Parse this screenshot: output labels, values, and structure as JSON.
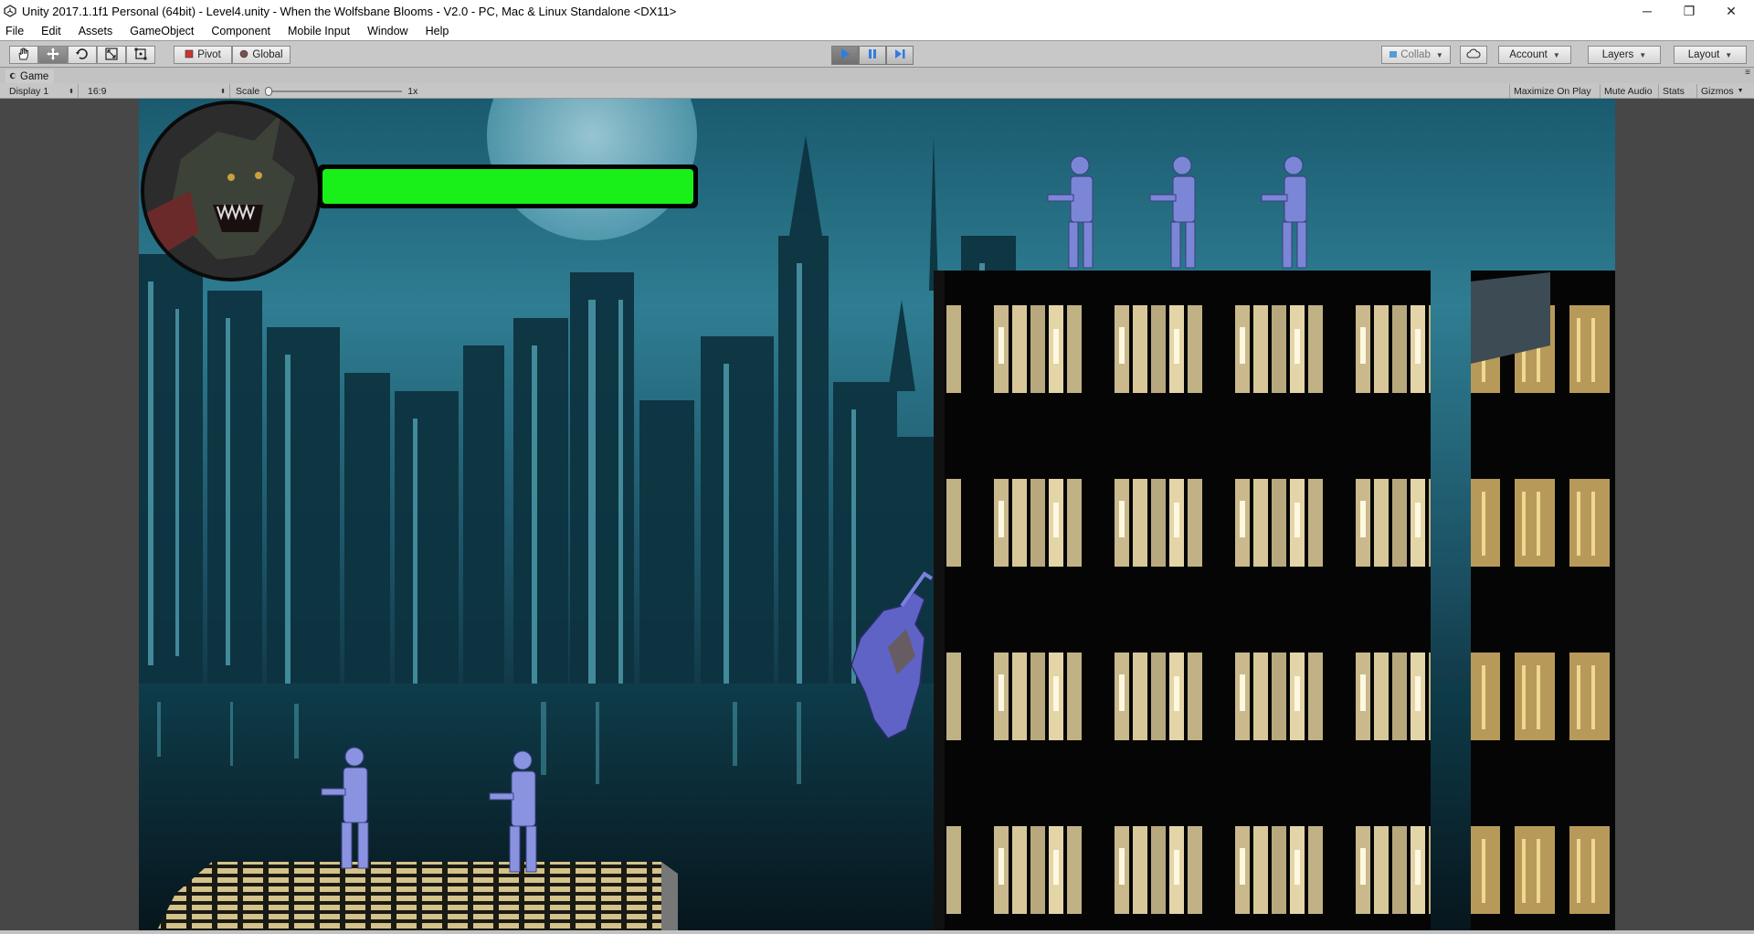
{
  "window": {
    "title": "Unity 2017.1.1f1 Personal (64bit) - Level4.unity - When the Wolfsbane Blooms - V2.0 - PC, Mac & Linux Standalone <DX11>",
    "minimize": "─",
    "maximize": "❐",
    "close": "✕"
  },
  "menu": [
    "File",
    "Edit",
    "Assets",
    "GameObject",
    "Component",
    "Mobile Input",
    "Window",
    "Help"
  ],
  "toolbar": {
    "pivot_label": "Pivot",
    "global_label": "Global",
    "collab_label": "Collab",
    "account_label": "Account",
    "layers_label": "Layers",
    "layout_label": "Layout",
    "transform_tools": [
      "hand-icon",
      "move-icon",
      "rotate-icon",
      "scale-icon",
      "rect-icon"
    ],
    "play_state": "playing"
  },
  "game_view": {
    "tab_label": "Game",
    "display": "Display 1",
    "aspect": "16:9",
    "scale_label": "Scale",
    "scale_value": "1x",
    "maximize_on_play": "Maximize On Play",
    "mute_audio": "Mute Audio",
    "stats": "Stats",
    "gizmos": "Gizmos"
  },
  "hud": {
    "health_fraction": 1.0,
    "health_color": "#19f019",
    "portrait": "werewolf-portrait-icon"
  },
  "colors": {
    "accent_blue": "#2f7de0",
    "toolbar_bg": "#c8c8c8",
    "viewport_bg": "#474747",
    "sky": "#2f7d92"
  }
}
